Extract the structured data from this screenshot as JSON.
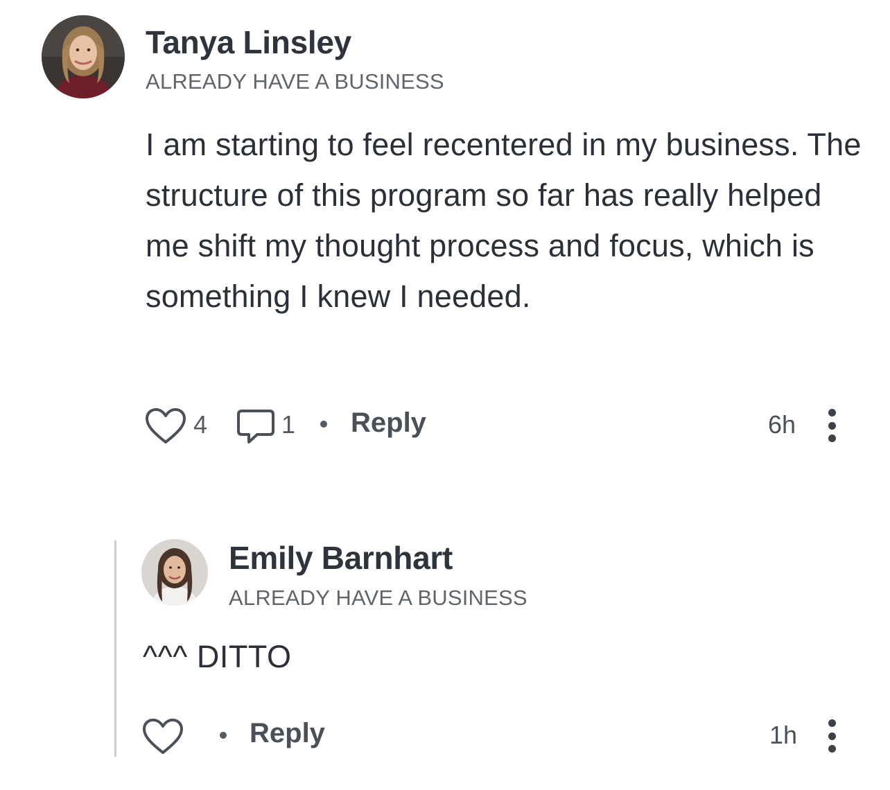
{
  "post": {
    "author": "Tanya Linsley",
    "tag": "ALREADY HAVE A BUSINESS",
    "body": "I am starting to feel recentered in my business. The structure of this program so far has really helped me shift my thought process and focus, which is something I knew I needed.",
    "like_count": "4",
    "comment_count": "1",
    "reply_label": "Reply",
    "time": "6h",
    "icons": {
      "like": "heart-icon",
      "comment": "comment-icon",
      "more": "more-vertical-icon"
    }
  },
  "reply": {
    "author": "Emily Barnhart",
    "tag": "ALREADY HAVE A BUSINESS",
    "body": "^^^ DITTO",
    "reply_label": "Reply",
    "time": "1h",
    "icons": {
      "like": "heart-icon",
      "more": "more-vertical-icon"
    }
  },
  "colors": {
    "text": "#2b2f38",
    "muted": "#60646d",
    "thread_line": "#c9ccd2"
  }
}
